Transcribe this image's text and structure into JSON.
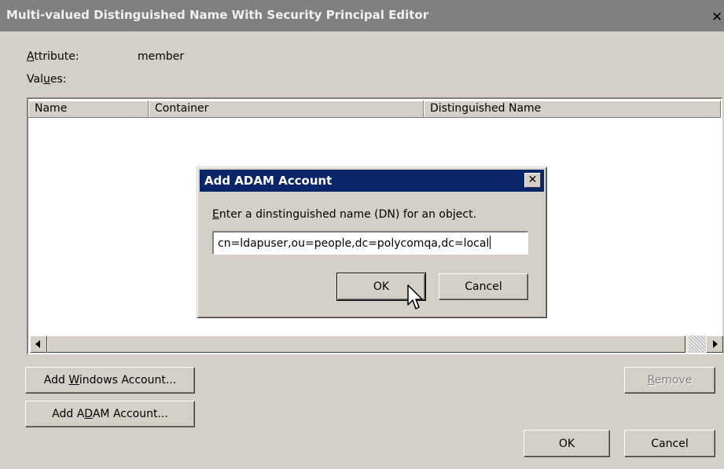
{
  "window": {
    "title": "Multi-valued Distinguished Name With Security Principal Editor",
    "close_glyph": "✕"
  },
  "attribute": {
    "label_key": "A",
    "label_rest": "ttribute:",
    "value": "member"
  },
  "values_label": {
    "pre": "Val",
    "key": "u",
    "post": "es:"
  },
  "list": {
    "columns": [
      "Name",
      "Container",
      "Distinguished Name"
    ],
    "rows": []
  },
  "buttons": {
    "add_windows": {
      "pre": "Add ",
      "key": "W",
      "post": "indows Account..."
    },
    "add_adam": {
      "pre": "Add A",
      "key": "D",
      "post": "AM Account..."
    },
    "remove": {
      "pre": "",
      "key": "R",
      "post": "emove"
    },
    "ok": "OK",
    "cancel": "Cancel"
  },
  "dialog": {
    "title": "Add ADAM Account",
    "close_glyph": "✕",
    "prompt_key": "E",
    "prompt_rest": "nter a dinstinguished name (DN) for an object.",
    "input_value": "cn=ldapuser,ou=people,dc=polycomqa,dc=local",
    "ok": "OK",
    "cancel": "Cancel"
  },
  "icons": [
    "close-icon",
    "scroll-left-arrow-icon",
    "scroll-right-arrow-icon",
    "mouse-pointer-icon"
  ],
  "colors": {
    "dialog_title_bar": "#0a246a",
    "inactive_title_bar": "#808080",
    "face": "#d4d0c8"
  }
}
